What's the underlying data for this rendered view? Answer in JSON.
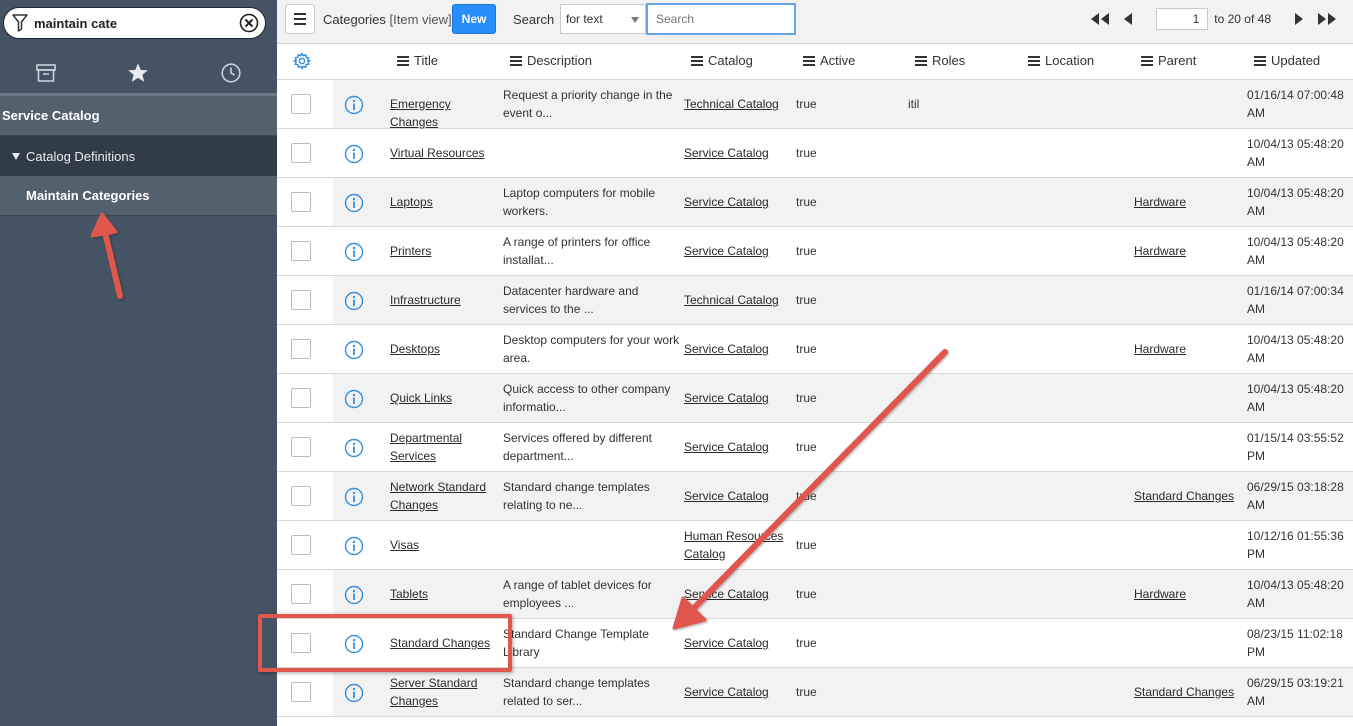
{
  "sidebar": {
    "filter_value": "maintain cate",
    "tabs": [
      "archive-icon",
      "star-icon",
      "clock-icon"
    ],
    "section": "Service Catalog",
    "module": "Catalog Definitions",
    "item": "Maintain Categories"
  },
  "header": {
    "title": "Categories",
    "view": "[Item view]",
    "new_label": "New",
    "search_label": "Search",
    "search_field": "for text",
    "search_placeholder": "Search",
    "page_value": "1",
    "page_range": "to 20 of 48"
  },
  "columns": [
    "Title",
    "Description",
    "Catalog",
    "Active",
    "Roles",
    "Location",
    "Parent",
    "Updated"
  ],
  "rows": [
    {
      "title": "Emergency Changes",
      "description": "Request a priority change in the event o...",
      "catalog": "Technical Catalog",
      "active": "true",
      "roles": "itil",
      "parent": "",
      "updated": "01/16/14 07:00:48 AM"
    },
    {
      "title": "Virtual Resources",
      "description": "",
      "catalog": "Service Catalog",
      "active": "true",
      "roles": "",
      "parent": "",
      "updated": "10/04/13 05:48:20 AM"
    },
    {
      "title": "Laptops",
      "description": "Laptop computers for mobile workers.",
      "catalog": "Service Catalog",
      "active": "true",
      "roles": "",
      "parent": "Hardware",
      "updated": "10/04/13 05:48:20 AM"
    },
    {
      "title": "Printers",
      "description": "A range of printers for office installat...",
      "catalog": "Service Catalog",
      "active": "true",
      "roles": "",
      "parent": "Hardware",
      "updated": "10/04/13 05:48:20 AM"
    },
    {
      "title": "Infrastructure",
      "description": "Datacenter hardware and services to the ...",
      "catalog": "Technical Catalog",
      "active": "true",
      "roles": "",
      "parent": "",
      "updated": "01/16/14 07:00:34 AM"
    },
    {
      "title": "Desktops",
      "description": "Desktop computers for your work area.",
      "catalog": "Service Catalog",
      "active": "true",
      "roles": "",
      "parent": "Hardware",
      "updated": "10/04/13 05:48:20 AM"
    },
    {
      "title": "Quick Links",
      "description": "Quick access to other company informatio...",
      "catalog": "Service Catalog",
      "active": "true",
      "roles": "",
      "parent": "",
      "updated": "10/04/13 05:48:20 AM"
    },
    {
      "title": "Departmental Services",
      "description": "Services offered by different department...",
      "catalog": "Service Catalog",
      "active": "true",
      "roles": "",
      "parent": "",
      "updated": "01/15/14 03:55:52 PM"
    },
    {
      "title": "Network Standard Changes",
      "description": "Standard change templates relating to ne...",
      "catalog": "Service Catalog",
      "active": "true",
      "roles": "",
      "parent": "Standard Changes",
      "updated": "06/29/15 03:18:28 AM"
    },
    {
      "title": "Visas",
      "description": "",
      "catalog": "Human Resources Catalog",
      "active": "true",
      "roles": "",
      "parent": "",
      "updated": "10/12/16 01:55:36 PM"
    },
    {
      "title": "Tablets",
      "description": "A range of tablet devices for employees ...",
      "catalog": "Service Catalog",
      "active": "true",
      "roles": "",
      "parent": "Hardware",
      "updated": "10/04/13 05:48:20 AM"
    },
    {
      "title": "Standard Changes",
      "description": "Standard Change Template Library",
      "catalog": "Service Catalog",
      "active": "true",
      "roles": "",
      "parent": "",
      "updated": "08/23/15 11:02:18 PM"
    },
    {
      "title": "Server Standard Changes",
      "description": "Standard change templates related to ser...",
      "catalog": "Service Catalog",
      "active": "true",
      "roles": "",
      "parent": "Standard Changes",
      "updated": "06/29/15 03:19:21 AM"
    }
  ],
  "colors": {
    "sidebar_bg": "#455464",
    "new_button": "#278efc",
    "annotation": "#e0574e",
    "info_icon": "#3a8fd9"
  }
}
